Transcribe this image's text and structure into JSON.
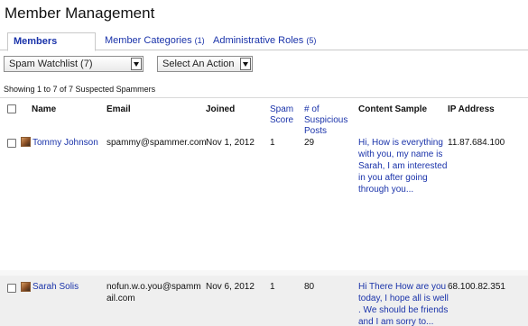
{
  "page": {
    "title": "Member Management"
  },
  "tabs": [
    {
      "label": "Members",
      "count": ""
    },
    {
      "label": "Member Categories",
      "count": "(1)"
    },
    {
      "label": "Administrative Roles",
      "count": "(5)"
    }
  ],
  "filters": {
    "watchlist": "Spam Watchlist (7)",
    "action": "Select An Action"
  },
  "showing_text": "Showing 1 to 7 of 7 Suspected Spammers",
  "columns": {
    "name": "Name",
    "email": "Email",
    "joined": "Joined",
    "spam_score": "Spam Score",
    "suspicious_posts": "# of Suspicious Posts",
    "content_sample": "Content Sample",
    "ip_address": "IP Address"
  },
  "rows": [
    {
      "name": "Tommy Johnson",
      "email": "spammy@spammer.com",
      "joined": "Nov 1, 2012",
      "spam_score": "1",
      "suspicious_posts": "29",
      "content_sample": "Hi, How is everything with you, my name is Sarah, I am interested in you after going through you...",
      "ip_address": "11.87.684.100"
    },
    {
      "name": "Sarah Solis",
      "email": "nofun.w.o.you@spammail.com",
      "joined": "Nov 6, 2012",
      "spam_score": "1",
      "suspicious_posts": "80",
      "content_sample": "Hi There How are you today, I hope all is well . We should be friends and I am sorry to...",
      "ip_address": "68.100.82.351"
    }
  ]
}
